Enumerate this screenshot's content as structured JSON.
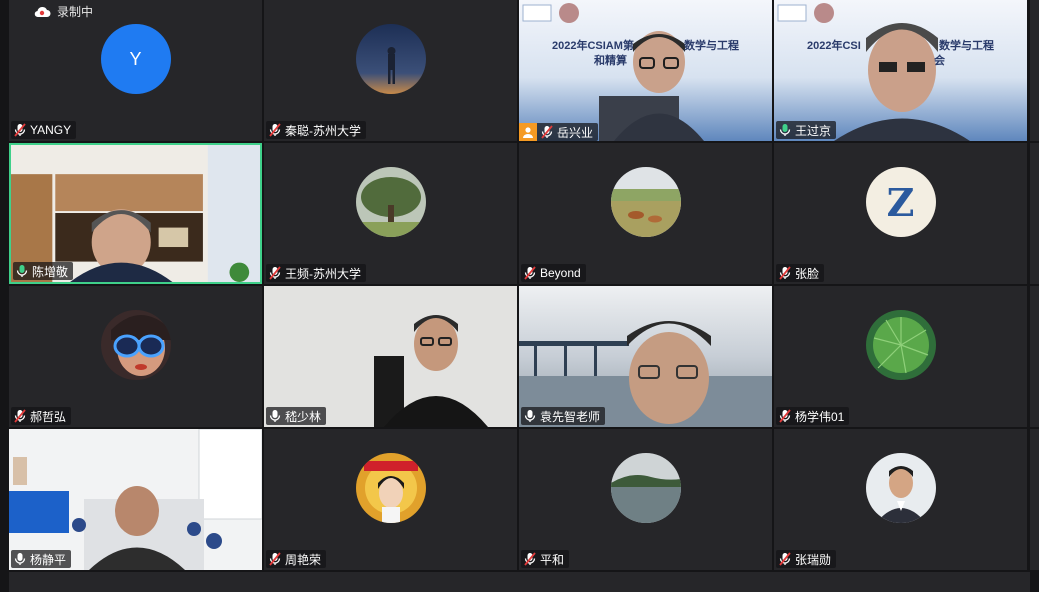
{
  "recording": {
    "label": "录制中"
  },
  "participants": [
    {
      "name": "YANGY",
      "avatar_letter": "Y",
      "mic": "muted"
    },
    {
      "name": "秦聪-苏州大学",
      "mic": "muted"
    },
    {
      "name": "岳兴业",
      "mic": "muted",
      "host": true
    },
    {
      "name": "王过京",
      "mic": "active"
    },
    {
      "name": "陈增敬",
      "mic": "active",
      "speaking": true
    },
    {
      "name": "王频-苏州大学",
      "mic": "muted"
    },
    {
      "name": "Beyond",
      "mic": "muted"
    },
    {
      "name": "张脸",
      "mic": "muted"
    },
    {
      "name": "郝哲弘",
      "mic": "muted"
    },
    {
      "name": "嵇少林",
      "mic": "on"
    },
    {
      "name": "袁先智老师",
      "mic": "on"
    },
    {
      "name": "杨学伟01",
      "mic": "muted"
    },
    {
      "name": "杨静平",
      "mic": "on"
    },
    {
      "name": "周艳荣",
      "mic": "muted"
    },
    {
      "name": "平和",
      "mic": "muted"
    },
    {
      "name": "张瑞勋",
      "mic": "muted"
    }
  ],
  "slide": {
    "title_left": "2022年CSIAM第",
    "title_right": "数学与工程",
    "subtitle_left": "和精算",
    "title_left_2": "2022年CSI",
    "title_right_2": "数学与工程",
    "subtitle_right_2": "会"
  },
  "avatar_icons": {
    "zhang_lian_letter": "Z"
  }
}
